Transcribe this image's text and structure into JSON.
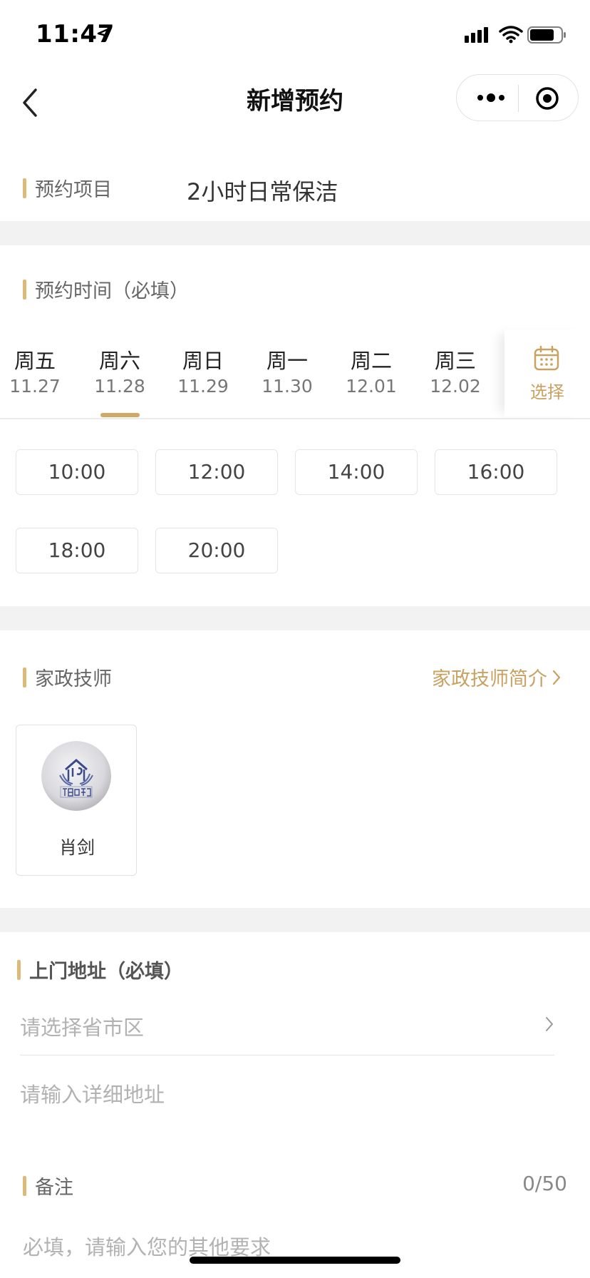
{
  "status_bar": {
    "time": "11:47"
  },
  "nav": {
    "title": "新增预约"
  },
  "project": {
    "label": "预约项目",
    "value": "2小时日常保洁"
  },
  "time_section": {
    "label": "预约时间（必填）",
    "tabs": [
      {
        "day": "周五",
        "date": "11.27"
      },
      {
        "day": "周六",
        "date": "11.28"
      },
      {
        "day": "周日",
        "date": "11.29"
      },
      {
        "day": "周一",
        "date": "11.30"
      },
      {
        "day": "周二",
        "date": "12.01"
      },
      {
        "day": "周三",
        "date": "12.02"
      }
    ],
    "selected_tab": "周六 11.28",
    "pick_label": "选择",
    "slots": [
      "10:00",
      "12:00",
      "14:00",
      "16:00",
      "18:00",
      "20:00"
    ]
  },
  "tech": {
    "label": "家政技师",
    "link": "家政技师简介",
    "card_name": "肖剑",
    "avatar_text": "镭电家政"
  },
  "address": {
    "label": "上门地址（必填）",
    "region_placeholder": "请选择省市区",
    "detail_placeholder": "请输入详细地址"
  },
  "remark": {
    "label": "备注",
    "count": "0/50",
    "placeholder": "必填，请输入您的其他要求"
  },
  "colors": {
    "accent": "#dcb979",
    "link": "#c9a161",
    "gap": "#f2f2f2"
  }
}
